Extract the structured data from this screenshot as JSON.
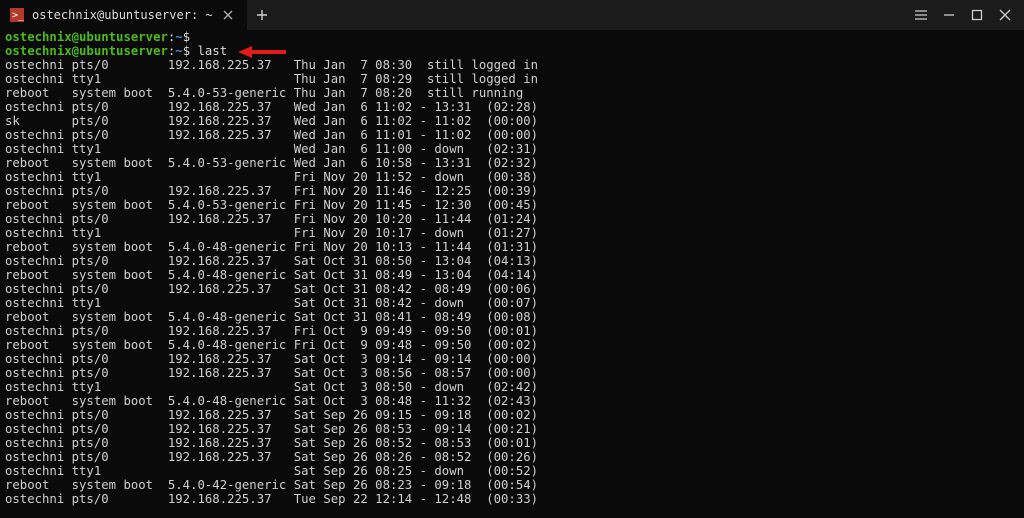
{
  "tab": {
    "title": "ostechnix@ubuntuserver: ~"
  },
  "prompts": [
    {
      "user_host": "ostechnix@ubuntuserver",
      "cwd": "~",
      "cmd": ""
    },
    {
      "user_host": "ostechnix@ubuntuserver",
      "cwd": "~",
      "cmd": "last"
    }
  ],
  "columns": [
    "user",
    "tty",
    "host",
    "time",
    "sep",
    "end",
    "dur"
  ],
  "rows": [
    {
      "user": "ostechni",
      "tty": "pts/0",
      "host": "192.168.225.37",
      "time": "Thu Jan  7 08:30",
      "sep": "",
      "end": "still logged in",
      "dur": ""
    },
    {
      "user": "ostechni",
      "tty": "tty1",
      "host": "",
      "time": "Thu Jan  7 08:29",
      "sep": "",
      "end": "still logged in",
      "dur": ""
    },
    {
      "user": "reboot",
      "tty": "system boot",
      "host": "5.4.0-53-generic",
      "time": "Thu Jan  7 08:20",
      "sep": "",
      "end": "still running",
      "dur": ""
    },
    {
      "user": "ostechni",
      "tty": "pts/0",
      "host": "192.168.225.37",
      "time": "Wed Jan  6 11:02",
      "sep": "-",
      "end": "13:31",
      "dur": "(02:28)"
    },
    {
      "user": "sk",
      "tty": "pts/0",
      "host": "192.168.225.37",
      "time": "Wed Jan  6 11:02",
      "sep": "-",
      "end": "11:02",
      "dur": "(00:00)"
    },
    {
      "user": "ostechni",
      "tty": "pts/0",
      "host": "192.168.225.37",
      "time": "Wed Jan  6 11:01",
      "sep": "-",
      "end": "11:02",
      "dur": "(00:00)"
    },
    {
      "user": "ostechni",
      "tty": "tty1",
      "host": "",
      "time": "Wed Jan  6 11:00",
      "sep": "-",
      "end": "down",
      "dur": "(02:31)"
    },
    {
      "user": "reboot",
      "tty": "system boot",
      "host": "5.4.0-53-generic",
      "time": "Wed Jan  6 10:58",
      "sep": "-",
      "end": "13:31",
      "dur": "(02:32)"
    },
    {
      "user": "ostechni",
      "tty": "tty1",
      "host": "",
      "time": "Fri Nov 20 11:52",
      "sep": "-",
      "end": "down",
      "dur": "(00:38)"
    },
    {
      "user": "ostechni",
      "tty": "pts/0",
      "host": "192.168.225.37",
      "time": "Fri Nov 20 11:46",
      "sep": "-",
      "end": "12:25",
      "dur": "(00:39)"
    },
    {
      "user": "reboot",
      "tty": "system boot",
      "host": "5.4.0-53-generic",
      "time": "Fri Nov 20 11:45",
      "sep": "-",
      "end": "12:30",
      "dur": "(00:45)"
    },
    {
      "user": "ostechni",
      "tty": "pts/0",
      "host": "192.168.225.37",
      "time": "Fri Nov 20 10:20",
      "sep": "-",
      "end": "11:44",
      "dur": "(01:24)"
    },
    {
      "user": "ostechni",
      "tty": "tty1",
      "host": "",
      "time": "Fri Nov 20 10:17",
      "sep": "-",
      "end": "down",
      "dur": "(01:27)"
    },
    {
      "user": "reboot",
      "tty": "system boot",
      "host": "5.4.0-48-generic",
      "time": "Fri Nov 20 10:13",
      "sep": "-",
      "end": "11:44",
      "dur": "(01:31)"
    },
    {
      "user": "ostechni",
      "tty": "pts/0",
      "host": "192.168.225.37",
      "time": "Sat Oct 31 08:50",
      "sep": "-",
      "end": "13:04",
      "dur": "(04:13)"
    },
    {
      "user": "reboot",
      "tty": "system boot",
      "host": "5.4.0-48-generic",
      "time": "Sat Oct 31 08:49",
      "sep": "-",
      "end": "13:04",
      "dur": "(04:14)"
    },
    {
      "user": "ostechni",
      "tty": "pts/0",
      "host": "192.168.225.37",
      "time": "Sat Oct 31 08:42",
      "sep": "-",
      "end": "08:49",
      "dur": "(00:06)"
    },
    {
      "user": "ostechni",
      "tty": "tty1",
      "host": "",
      "time": "Sat Oct 31 08:42",
      "sep": "-",
      "end": "down",
      "dur": "(00:07)"
    },
    {
      "user": "reboot",
      "tty": "system boot",
      "host": "5.4.0-48-generic",
      "time": "Sat Oct 31 08:41",
      "sep": "-",
      "end": "08:49",
      "dur": "(00:08)"
    },
    {
      "user": "ostechni",
      "tty": "pts/0",
      "host": "192.168.225.37",
      "time": "Fri Oct  9 09:49",
      "sep": "-",
      "end": "09:50",
      "dur": "(00:01)"
    },
    {
      "user": "reboot",
      "tty": "system boot",
      "host": "5.4.0-48-generic",
      "time": "Fri Oct  9 09:48",
      "sep": "-",
      "end": "09:50",
      "dur": "(00:02)"
    },
    {
      "user": "ostechni",
      "tty": "pts/0",
      "host": "192.168.225.37",
      "time": "Sat Oct  3 09:14",
      "sep": "-",
      "end": "09:14",
      "dur": "(00:00)"
    },
    {
      "user": "ostechni",
      "tty": "pts/0",
      "host": "192.168.225.37",
      "time": "Sat Oct  3 08:56",
      "sep": "-",
      "end": "08:57",
      "dur": "(00:00)"
    },
    {
      "user": "ostechni",
      "tty": "tty1",
      "host": "",
      "time": "Sat Oct  3 08:50",
      "sep": "-",
      "end": "down",
      "dur": "(02:42)"
    },
    {
      "user": "reboot",
      "tty": "system boot",
      "host": "5.4.0-48-generic",
      "time": "Sat Oct  3 08:48",
      "sep": "-",
      "end": "11:32",
      "dur": "(02:43)"
    },
    {
      "user": "ostechni",
      "tty": "pts/0",
      "host": "192.168.225.37",
      "time": "Sat Sep 26 09:15",
      "sep": "-",
      "end": "09:18",
      "dur": "(00:02)"
    },
    {
      "user": "ostechni",
      "tty": "pts/0",
      "host": "192.168.225.37",
      "time": "Sat Sep 26 08:53",
      "sep": "-",
      "end": "09:14",
      "dur": "(00:21)"
    },
    {
      "user": "ostechni",
      "tty": "pts/0",
      "host": "192.168.225.37",
      "time": "Sat Sep 26 08:52",
      "sep": "-",
      "end": "08:53",
      "dur": "(00:01)"
    },
    {
      "user": "ostechni",
      "tty": "pts/0",
      "host": "192.168.225.37",
      "time": "Sat Sep 26 08:26",
      "sep": "-",
      "end": "08:52",
      "dur": "(00:26)"
    },
    {
      "user": "ostechni",
      "tty": "tty1",
      "host": "",
      "time": "Sat Sep 26 08:25",
      "sep": "-",
      "end": "down",
      "dur": "(00:52)"
    },
    {
      "user": "reboot",
      "tty": "system boot",
      "host": "5.4.0-42-generic",
      "time": "Sat Sep 26 08:23",
      "sep": "-",
      "end": "09:18",
      "dur": "(00:54)"
    },
    {
      "user": "ostechni",
      "tty": "pts/0",
      "host": "192.168.225.37",
      "time": "Tue Sep 22 12:14",
      "sep": "-",
      "end": "12:48",
      "dur": "(00:33)"
    }
  ]
}
